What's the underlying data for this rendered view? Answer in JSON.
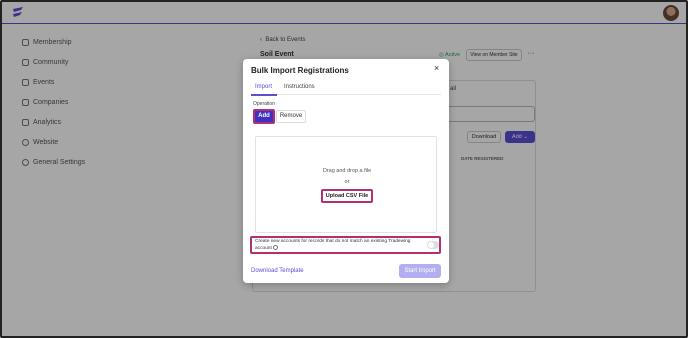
{
  "sidebar": {
    "items": [
      {
        "label": "Membership",
        "icon": "users-icon"
      },
      {
        "label": "Community",
        "icon": "community-icon"
      },
      {
        "label": "Events",
        "icon": "calendar-icon"
      },
      {
        "label": "Companies",
        "icon": "briefcase-icon"
      },
      {
        "label": "Analytics",
        "icon": "analytics-icon"
      },
      {
        "label": "Website",
        "icon": "globe-icon"
      },
      {
        "label": "General Settings",
        "icon": "gear-icon"
      }
    ]
  },
  "page": {
    "back_label": "Back to Events",
    "event_title": "Soil Event",
    "status": "Active",
    "view_member_site": "View on Member Site",
    "more": "···",
    "partial_tab": "ail",
    "download": "Download",
    "add": "Add",
    "date_registered_header": "DATE REGISTERED"
  },
  "modal": {
    "title": "Bulk Import Registrations",
    "close": "×",
    "tabs": {
      "import": "Import",
      "instructions": "Instructions"
    },
    "operation_label": "Operation",
    "add_label": "Add",
    "remove_label": "Remove",
    "drag_text": "Drag and drop a file",
    "or_text": "or",
    "upload_label": "Upload CSV File",
    "create_accounts_text": "Create new accounts for records that do not match an existing Tradewing account",
    "create_accounts_enabled": false,
    "download_template": "Download Template",
    "start_import": "Start Import"
  },
  "colors": {
    "accent": "#5b4fd6",
    "highlight": "#b03070",
    "active_green": "#2e9b57"
  }
}
